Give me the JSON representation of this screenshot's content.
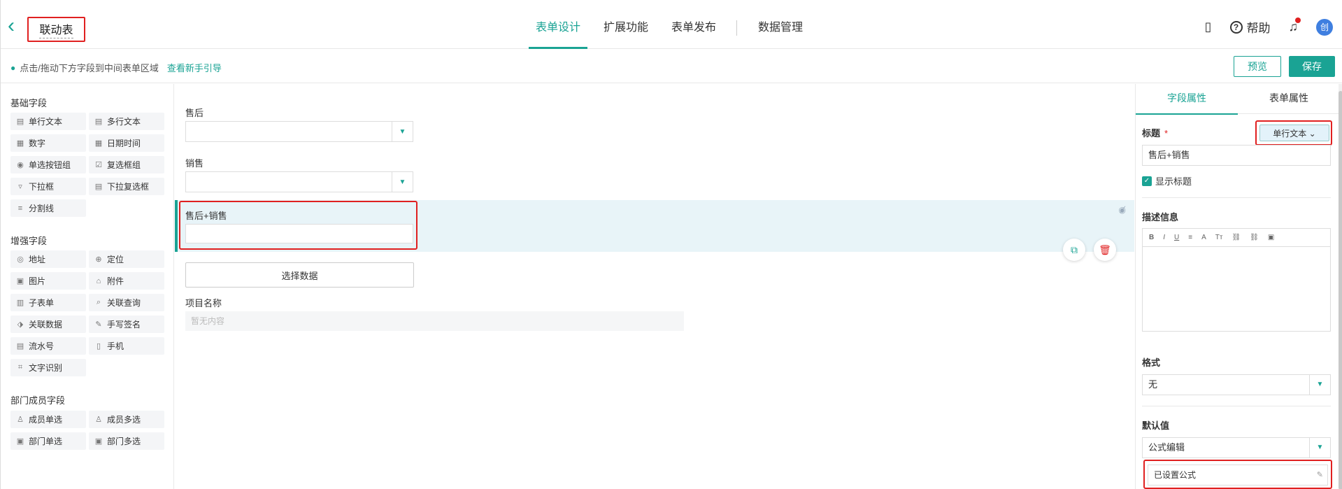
{
  "header": {
    "title": "联动表",
    "tabs": [
      "表单设计",
      "扩展功能",
      "表单发布",
      "数据管理"
    ],
    "help_label": "帮助",
    "avatar_text": "创"
  },
  "subbar": {
    "hint": "点击/拖动下方字段到中间表单区域",
    "guide_link": "查看新手引导",
    "preview_label": "预览",
    "save_label": "保存"
  },
  "left": {
    "basic_title": "基础字段",
    "basic": [
      "单行文本",
      "多行文本",
      "数字",
      "日期时间",
      "单选按钮组",
      "复选框组",
      "下拉框",
      "下拉复选框",
      "分割线"
    ],
    "enhanced_title": "增强字段",
    "enhanced": [
      "地址",
      "定位",
      "图片",
      "附件",
      "子表单",
      "关联查询",
      "关联数据",
      "手写签名",
      "流水号",
      "手机",
      "文字识别"
    ],
    "member_title": "部门成员字段",
    "member": [
      "成员单选",
      "成员多选",
      "部门单选",
      "部门多选"
    ]
  },
  "canvas": {
    "field1_label": "售后",
    "field2_label": "销售",
    "field3_label": "售后+销售",
    "choose_button": "选择数据",
    "field4_label": "项目名称",
    "field4_placeholder": "暂无内容"
  },
  "right": {
    "tabs": [
      "字段属性",
      "表单属性"
    ],
    "title_label": "标题",
    "type_button": "单行文本",
    "title_value": "售后+销售",
    "show_title": "显示标题",
    "desc_label": "描述信息",
    "format_label": "格式",
    "format_value": "无",
    "default_label": "默认值",
    "default_mode": "公式编辑",
    "formula_status": "已设置公式"
  },
  "colors": {
    "accent": "#1aa394",
    "highlight": "#e02020",
    "selected_row": "#e8f4f8"
  }
}
